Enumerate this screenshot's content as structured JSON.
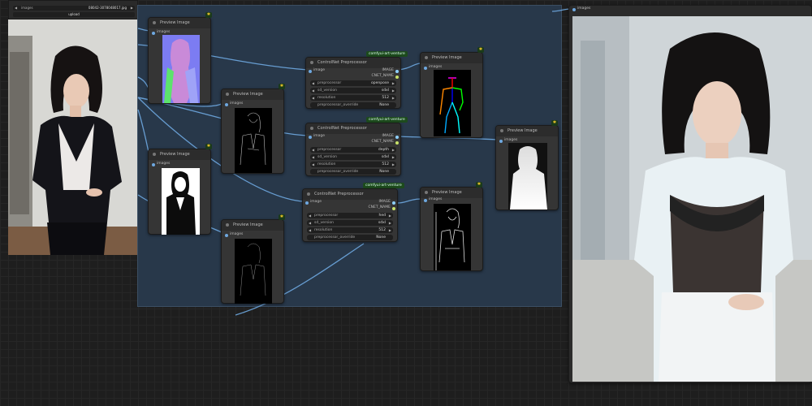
{
  "top_strip": {
    "node_label": "images",
    "filename": "08042-3078048017.jpg",
    "upload_label": "upload"
  },
  "preview_nodes": [
    {
      "title": "Preview Image",
      "input": "images"
    },
    {
      "title": "Preview Image",
      "input": "images"
    },
    {
      "title": "Preview Image",
      "input": "images"
    },
    {
      "title": "Preview Image",
      "input": "images"
    },
    {
      "title": "Preview Image",
      "input": "images"
    },
    {
      "title": "Preview Image",
      "input": "images"
    },
    {
      "title": "Preview Image",
      "input": "images"
    }
  ],
  "controlnet_nodes": [
    {
      "tag": "comfyui-art-venture",
      "title": "ControlNet Preprocessor",
      "input": "image",
      "outputs": [
        "IMAGE",
        "CNET_NAME"
      ],
      "widgets": [
        {
          "label": "preprocessor",
          "value": "openpose"
        },
        {
          "label": "sd_version",
          "value": "sdxl"
        },
        {
          "label": "resolution",
          "value": "512"
        },
        {
          "label": "preprocessor_override",
          "value": "None"
        }
      ]
    },
    {
      "tag": "comfyui-art-venture",
      "title": "ControlNet Preprocessor",
      "input": "image",
      "outputs": [
        "IMAGE",
        "CNET_NAME"
      ],
      "widgets": [
        {
          "label": "preprocessor",
          "value": "depth"
        },
        {
          "label": "sd_version",
          "value": "sdxl"
        },
        {
          "label": "resolution",
          "value": "512"
        },
        {
          "label": "preprocessor_override",
          "value": "None"
        }
      ]
    },
    {
      "tag": "comfyui-art-venture",
      "title": "ControlNet Preprocessor",
      "input": "image",
      "outputs": [
        "IMAGE",
        "CNET_NAME"
      ],
      "widgets": [
        {
          "label": "preprocessor",
          "value": "hed"
        },
        {
          "label": "sd_version",
          "value": "sdxl"
        },
        {
          "label": "resolution",
          "value": "512"
        },
        {
          "label": "preprocessor_override",
          "value": "None"
        }
      ]
    }
  ],
  "right_panel": {
    "label": "images"
  },
  "colors": {
    "canvas": "#1e1e1e",
    "group_bg": "#28384a",
    "node_bg": "#353535",
    "link": "#6ea8e0",
    "tag_bg": "#1d4b1d"
  }
}
